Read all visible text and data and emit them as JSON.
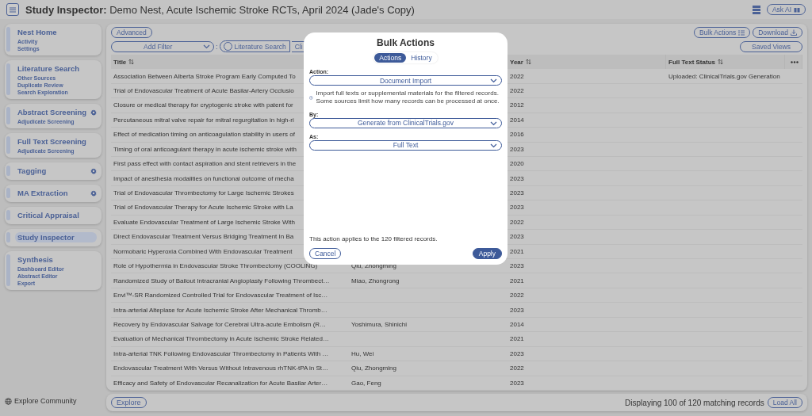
{
  "header": {
    "title_bold": "Study Inspector:",
    "title": "Demo Nest, Acute Ischemic Stroke RCTs, April 2024 (Jade's Copy)",
    "ask_ai": "Ask AI"
  },
  "sidebar": {
    "sections": [
      {
        "title": "Nest Home",
        "gear": false,
        "selected": false,
        "links": [
          "Activity",
          "Settings"
        ]
      },
      {
        "title": "Literature Search",
        "gear": false,
        "selected": false,
        "links": [
          "Other Sources",
          "Duplicate Review",
          "Search Exploration"
        ]
      },
      {
        "title": "Abstract Screening",
        "gear": true,
        "selected": false,
        "links": [
          "Adjudicate Screening"
        ]
      },
      {
        "title": "Full Text Screening",
        "gear": false,
        "selected": false,
        "links": [
          "Adjudicate Screening"
        ]
      },
      {
        "title": "Tagging",
        "gear": true,
        "selected": false
      },
      {
        "title": "MA Extraction",
        "gear": true,
        "selected": false
      },
      {
        "title": "Critical Appraisal",
        "gear": false,
        "selected": false
      },
      {
        "title": "Study Inspector",
        "gear": false,
        "selected": true
      },
      {
        "title": "Synthesis",
        "gear": false,
        "selected": false,
        "links": [
          "Dashboard Editor",
          "Abstract Editor",
          "Export"
        ]
      }
    ],
    "footer": "Explore Community"
  },
  "toolbar": {
    "advanced": "Advanced",
    "bulk_actions": "Bulk Actions",
    "download": "Download",
    "add_filter": "Add Filter",
    "separator": ":",
    "filter_chips": [
      "Literature Search",
      "Cli"
    ],
    "saved_views": "Saved Views"
  },
  "table": {
    "columns": [
      "Title",
      "Year",
      "Full Text Status"
    ],
    "rows": [
      {
        "title": "Association Between Alberta Stroke Program Early Computed To",
        "year": "2022",
        "status": "Uploaded: ClinicalTrials.gov Generation"
      },
      {
        "title": "Trial of Endovascular Treatment of Acute Basilar-Artery Occlusio",
        "year": "2022"
      },
      {
        "title": "Closure or medical therapy for cryptogenic stroke with patent for",
        "year": "2012"
      },
      {
        "title": "Percutaneous mitral valve repair for mitral regurgitation in high-ri",
        "year": "2014"
      },
      {
        "title": "Effect of medication timing on anticoagulation stability in users of",
        "year": "2016"
      },
      {
        "title": "Timing of oral anticoagulant therapy in acute ischemic stroke with",
        "year": "2023"
      },
      {
        "title": "First pass effect with contact aspiration and stent retrievers in the",
        "year": "2020"
      },
      {
        "title": "Impact of anesthesia modalities on functional outcome of mecha",
        "year": "2023"
      },
      {
        "title": "Trial of Endovascular Thrombectomy for Large Ischemic Strokes",
        "year": "2023"
      },
      {
        "title": "Trial of Endovascular Therapy for Acute Ischemic Stroke with La",
        "year": "2023"
      },
      {
        "title": "Evaluate Endovascular Treatment of Large Ischemic Stroke With",
        "year": "2022"
      },
      {
        "title": "Direct Endovascular Treatment Versus Bridging Treatment In Ba",
        "year": "2023"
      },
      {
        "title": "Normobaric Hyperoxia Combined With Endovascular Treatment",
        "year": "2021"
      },
      {
        "title": "Role of Hypothermia in Endovascular Stroke Thrombectomy (COOLING)",
        "author": "Qiu, Zhongming",
        "year": "2023"
      },
      {
        "title": "Randomized Study of Bailout Intracranial Angioplasty Following Thrombect…",
        "author": "Miao, Zhongrong",
        "year": "2021"
      },
      {
        "title": "Envi™-SR Randomized Controlled Trial for Endovascular Treatment of Isc…",
        "year": "2022"
      },
      {
        "title": "Intra-arterial Alteplase for Acute Ischemic Stroke After Mechanical Thromb…",
        "year": "2023"
      },
      {
        "title": "Recovery by Endovascular Salvage for Cerebral Ultra-acute Embolism (R…",
        "author": "Yoshimura, Shinichi",
        "year": "2014"
      },
      {
        "title": "Evaluation of Mechanical Thrombectomy in Acute Ischemic Stroke Related…",
        "year": "2021"
      },
      {
        "title": "Intra-arterial TNK Following Endovascular Thrombectomy in Patients With …",
        "author": "Hu, Wei",
        "year": "2023"
      },
      {
        "title": "Endovascular Treatment With Versus Without Intravenous rhTNK-tPA in St…",
        "author": "Qiu, Zhongming",
        "year": "2022"
      },
      {
        "title": "Efficacy and Safety of Endovascular Recanalization for Acute Basilar Arter…",
        "author": "Gao, Feng",
        "year": "2023"
      }
    ]
  },
  "footer": {
    "explore": "Explore",
    "displaying": "Displaying 100 of 120 matching records",
    "load_all": "Load All"
  },
  "modal": {
    "title": "Bulk Actions",
    "tabs": [
      {
        "label": "Actions",
        "selected": true
      },
      {
        "label": "History",
        "selected": false
      }
    ],
    "fields": [
      {
        "label": "Action:",
        "value": "Document Import",
        "help": "Import full texts or supplemental materials for the filtered records. Some sources limit how many records can be processed at once."
      },
      {
        "label": "By:",
        "value": "Generate from ClinicalTrials.gov"
      },
      {
        "label": "As:",
        "value": "Full Text"
      }
    ],
    "note": "This action applies to the 120 filtered records.",
    "cancel": "Cancel",
    "apply": "Apply"
  }
}
